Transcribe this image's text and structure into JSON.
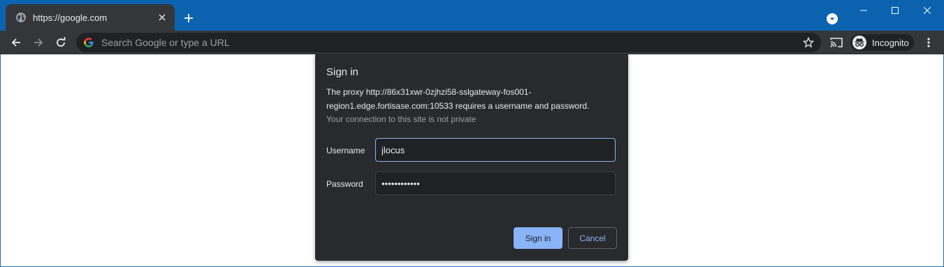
{
  "tab": {
    "title": "https://google.com"
  },
  "omnibox": {
    "placeholder": "Search Google or type a URL"
  },
  "incognito": {
    "label": "Incognito"
  },
  "dialog": {
    "title": "Sign in",
    "message_line1": "The proxy http://86x31xwr-0zjhzi58-sslgateway-fos001-",
    "message_line2": "region1.edge.fortisase.com:10533 requires a username and password.",
    "subtext": "Your connection to this site is not private",
    "username_label": "Username",
    "username_value": "jlocus",
    "password_label": "Password",
    "password_value": "••••••••••••",
    "signin_label": "Sign in",
    "cancel_label": "Cancel"
  },
  "colors": {
    "titlebar": "#0b63b0",
    "toolbar": "#35363a",
    "dialog_bg": "#292a2d",
    "accent": "#8ab4f8"
  },
  "icons": [
    "globe-icon",
    "close-icon",
    "plus-icon",
    "tab-search-icon",
    "minimize-icon",
    "maximize-icon",
    "window-close-icon",
    "back-icon",
    "forward-icon",
    "reload-icon",
    "google-g-icon",
    "star-icon",
    "cast-icon",
    "incognito-icon",
    "more-menu-icon"
  ]
}
